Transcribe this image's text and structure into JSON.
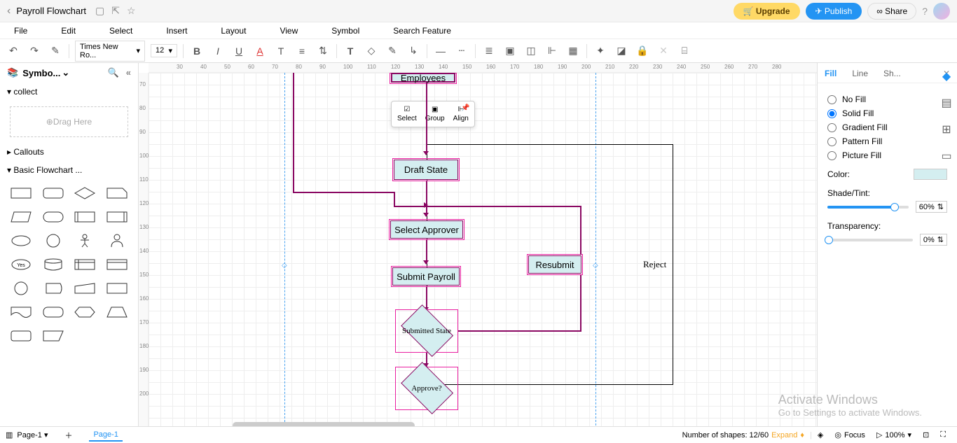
{
  "topbar": {
    "title": "Payroll Flowchart",
    "upgrade": "Upgrade",
    "publish": "Publish",
    "share": "Share"
  },
  "menubar": {
    "file": "File",
    "edit": "Edit",
    "select": "Select",
    "insert": "Insert",
    "layout": "Layout",
    "view": "View",
    "symbol": "Symbol",
    "search": "Search Feature"
  },
  "toolbar": {
    "font": "Times New Ro...",
    "size": "12"
  },
  "sidebar": {
    "title": "Symbo...",
    "drag": "Drag Here",
    "sections": {
      "collect": "collect",
      "callouts": "Callouts",
      "basic": "Basic Flowchart ..."
    }
  },
  "popup": {
    "select": "Select",
    "group": "Group",
    "align": "Align"
  },
  "flowchart": {
    "employees": "Employees",
    "draft": "Draft State",
    "selectApprover": "Select Approver",
    "submit": "Submit Payroll",
    "submitted": "Submitted State",
    "approve": "Approve?",
    "resubmit": "Resubmit",
    "reject": "Reject"
  },
  "rightpanel": {
    "tabs": {
      "fill": "Fill",
      "line": "Line",
      "shape": "Sh..."
    },
    "nofill": "No Fill",
    "solid": "Solid Fill",
    "gradient": "Gradient Fill",
    "pattern": "Pattern Fill",
    "picture": "Picture Fill",
    "color": "Color:",
    "shade": "Shade/Tint:",
    "shadeval": "60%",
    "transparency": "Transparency:",
    "transval": "0%"
  },
  "bottombar": {
    "page": "Page-1",
    "pagetab": "Page-1",
    "shapecount": "Number of shapes: 12/60",
    "expand": "Expand",
    "focus": "Focus",
    "zoom": "100%"
  },
  "watermark": {
    "t1": "Activate Windows",
    "t2": "Go to Settings to activate Windows."
  },
  "ruler_h": [
    "30",
    "40",
    "50",
    "60",
    "70",
    "80",
    "90",
    "100",
    "110",
    "120",
    "130",
    "140",
    "150",
    "160",
    "170",
    "180",
    "190",
    "200",
    "210",
    "220",
    "230",
    "240",
    "250",
    "260",
    "270",
    "280"
  ],
  "ruler_v": [
    "70",
    "80",
    "90",
    "100",
    "110",
    "120",
    "130",
    "140",
    "150",
    "160",
    "170",
    "180",
    "190",
    "200"
  ]
}
